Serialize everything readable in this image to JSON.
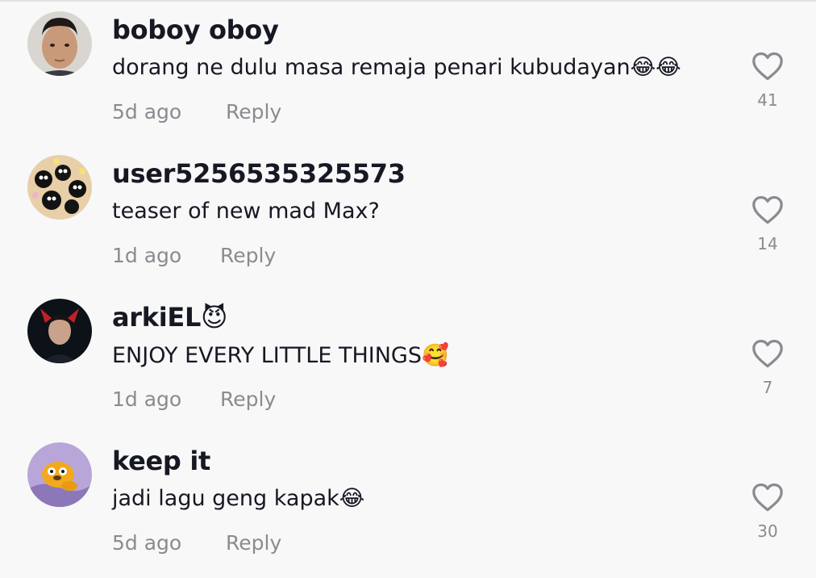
{
  "comments": [
    {
      "username": "boboy oboy",
      "text": "dorang ne dulu masa remaja penari kubudayan😂😂",
      "time": "5d ago",
      "reply_label": "Reply",
      "likes": "41"
    },
    {
      "username": "user5256535325573",
      "text": "teaser of new mad Max?",
      "time": "1d ago",
      "reply_label": "Reply",
      "likes": "14"
    },
    {
      "username": "arkiEL😈",
      "text": "ENJOY EVERY LITTLE THINGS🥰",
      "time": "1d ago",
      "reply_label": "Reply",
      "likes": "7"
    },
    {
      "username": "keep it",
      "text": "jadi lagu geng kapak😂",
      "time": "5d ago",
      "reply_label": "Reply",
      "likes": "30"
    }
  ],
  "colors": {
    "background": "#f8f8f8",
    "text": "#161823",
    "muted": "#8a8b91"
  },
  "icons": {
    "like": "heart-outline-icon"
  }
}
